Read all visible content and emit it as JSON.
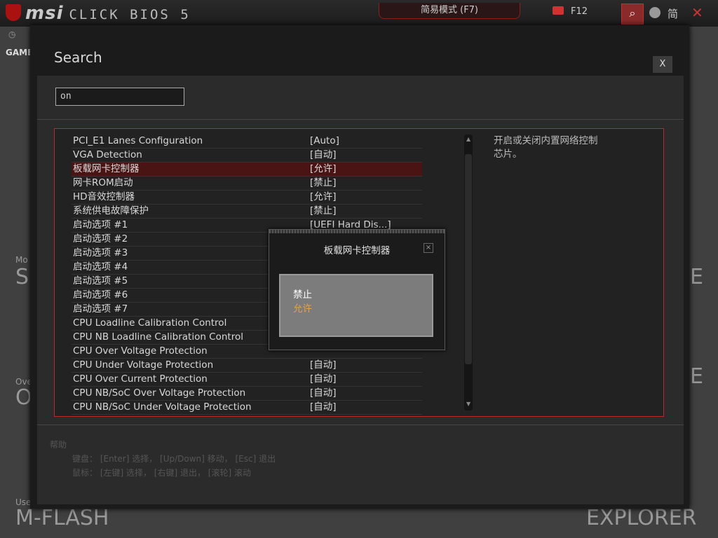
{
  "header": {
    "brand": "msi",
    "product": "CLICK BIOS 5",
    "mode_button": "简易模式 (F7)",
    "screenshot_key": "F12",
    "language": "简",
    "bg_label_game": "GAME",
    "colors": {
      "accent": "#b52a2a",
      "selected_row": "#4a1414",
      "option_highlight": "#e8a040"
    }
  },
  "background": {
    "left_labels": [
      "Mo",
      "SI",
      "Ove",
      "O",
      "Use",
      "M-FLASH"
    ],
    "right_labels": [
      "E",
      "E",
      "EXPLORER"
    ]
  },
  "dialog": {
    "title": "Search",
    "close_label": "X",
    "search_value": "on",
    "help_description": "开启或关闭内置网络控制芯片。",
    "rows": [
      {
        "name": "PCI_E1 Lanes Configuration",
        "value": "[Auto]"
      },
      {
        "name": "VGA Detection",
        "value": "[自动]"
      },
      {
        "name": "板载网卡控制器",
        "value": "[允许]"
      },
      {
        "name": "网卡ROM启动",
        "value": "[禁止]"
      },
      {
        "name": "HD音效控制器",
        "value": "[允许]"
      },
      {
        "name": "系统供电故障保护",
        "value": "[禁止]"
      },
      {
        "name": "启动选项 #1",
        "value": "[UEFI Hard Dis...]"
      },
      {
        "name": "启动选项 #2",
        "value": ""
      },
      {
        "name": "启动选项 #3",
        "value": ""
      },
      {
        "name": "启动选项 #4",
        "value": ""
      },
      {
        "name": "启动选项 #5",
        "value": ""
      },
      {
        "name": "启动选项 #6",
        "value": ""
      },
      {
        "name": "启动选项 #7",
        "value": ""
      },
      {
        "name": "CPU Loadline Calibration Control",
        "value": ""
      },
      {
        "name": "CPU NB Loadline Calibration Control",
        "value": ""
      },
      {
        "name": "CPU Over Voltage Protection",
        "value": ""
      },
      {
        "name": "CPU Under Voltage Protection",
        "value": "[自动]"
      },
      {
        "name": "CPU Over Current Protection",
        "value": "[自动]"
      },
      {
        "name": "CPU NB/SoC Over Voltage Protection",
        "value": "[自动]"
      },
      {
        "name": "CPU NB/SoC Under Voltage Protection",
        "value": "[自动]"
      }
    ],
    "help_title": "帮助",
    "help_keyboard": "键盘：  [Enter] 选择，  [Up/Down] 移动，  [Esc] 退出",
    "help_mouse": "鼠标：  [左键] 选择，  [右键] 退出，  [滚轮] 滚动"
  },
  "popup": {
    "title": "板载网卡控制器",
    "close_label": "×",
    "options": [
      "禁止",
      "允许"
    ]
  }
}
